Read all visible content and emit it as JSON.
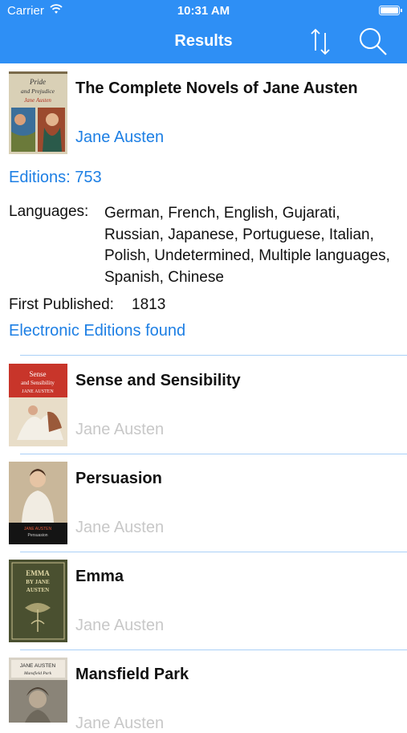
{
  "status_bar": {
    "carrier": "Carrier",
    "time": "10:31 AM"
  },
  "nav": {
    "title": "Results",
    "sort_icon": "sort-arrows-icon",
    "search_icon": "search-icon"
  },
  "featured": {
    "title": "The Complete Novels of Jane Austen",
    "author": "Jane Austen",
    "editions": "Editions: 753",
    "languages_label": "Languages:",
    "languages": "German, French, English, Gujarati, Russian, Japanese, Portuguese, Italian, Polish, Undetermined, Multiple languages, Spanish, Chinese",
    "first_published_label": "First Published:",
    "first_published": "1813",
    "electronic": "Electronic Editions found",
    "cover_text": {
      "line1": "Pride",
      "line2": "and Prejudice",
      "line3": "Jane Austen"
    }
  },
  "results": [
    {
      "title": "Sense and Sensibility",
      "author": "Jane Austen",
      "cover_text": {
        "line1": "Sense",
        "line2": "and Sensibility",
        "line3": "JANE AUSTEN"
      }
    },
    {
      "title": "Persuasion",
      "author": "Jane Austen",
      "cover_text": {
        "line1": "JANE AUSTEN",
        "line2": "Persuasion"
      }
    },
    {
      "title": "Emma",
      "author": "Jane Austen",
      "cover_text": {
        "line1": "EMMA",
        "line2": "BY JANE",
        "line3": "AUSTEN"
      }
    },
    {
      "title": "Mansfield Park",
      "author": "Jane Austen",
      "cover_text": {
        "line1": "JANE AUSTEN",
        "line2": "Mansfield Park"
      }
    }
  ],
  "colors": {
    "nav_bg": "#2e8ff5",
    "link": "#1d7fe4",
    "muted_author": "#c8c8c8",
    "separator": "#aad0f7"
  }
}
